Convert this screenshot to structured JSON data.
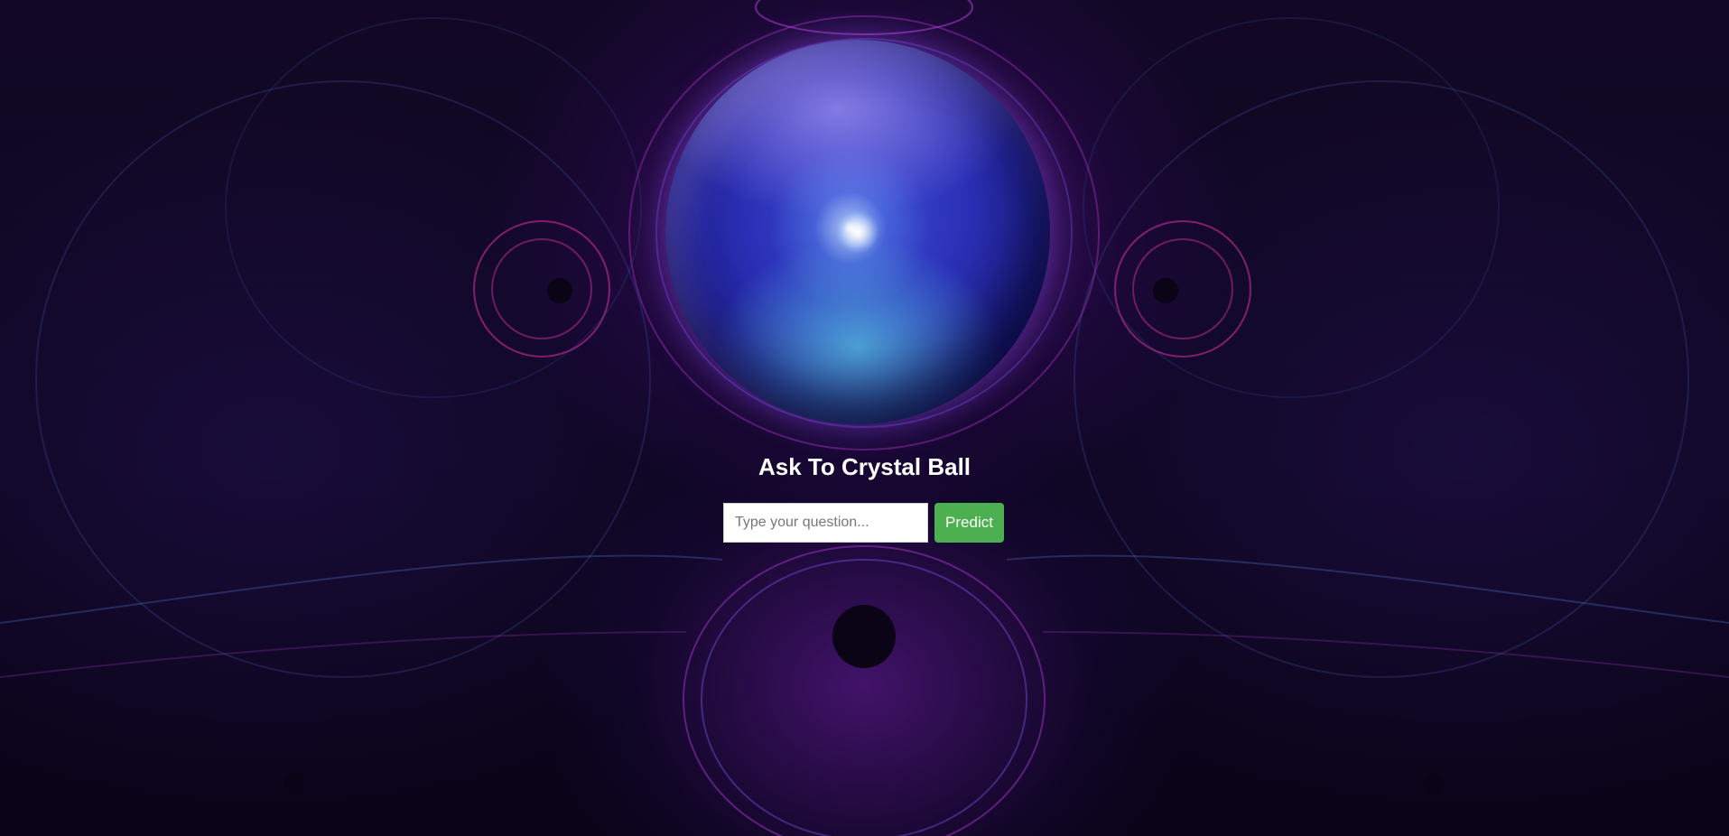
{
  "page": {
    "title": "Ask To Crystal Ball"
  },
  "form": {
    "input_placeholder": "Type your question...",
    "input_value": "",
    "submit_label": "Predict"
  },
  "colors": {
    "background": "#0d0620",
    "accent_purple": "#a020f0",
    "button": "#4caf50",
    "title_text": "#ffffff"
  },
  "images": {
    "background": "fractal-pattern",
    "crystal_ball": "crystal-ball-image"
  }
}
